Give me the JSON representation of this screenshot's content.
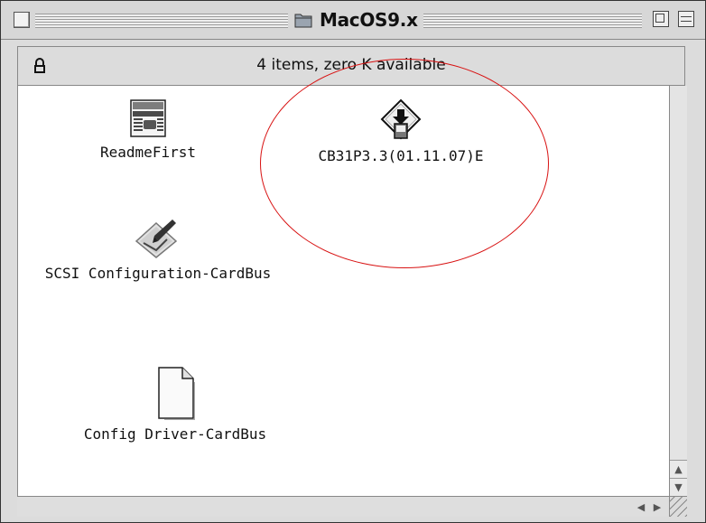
{
  "window": {
    "title": "MacOS9.x",
    "status": "4 items, zero K available"
  },
  "items": [
    {
      "label": "ReadmeFirst",
      "icon": "readme-document-icon"
    },
    {
      "label": "CB31P3.3(01.11.07)E",
      "icon": "installer-package-icon"
    },
    {
      "label": "SCSI Configuration-CardBus",
      "icon": "control-panel-icon"
    },
    {
      "label": "Config Driver-CardBus",
      "icon": "blank-document-icon"
    }
  ],
  "annotation": {
    "highlight_color": "#d81212"
  }
}
